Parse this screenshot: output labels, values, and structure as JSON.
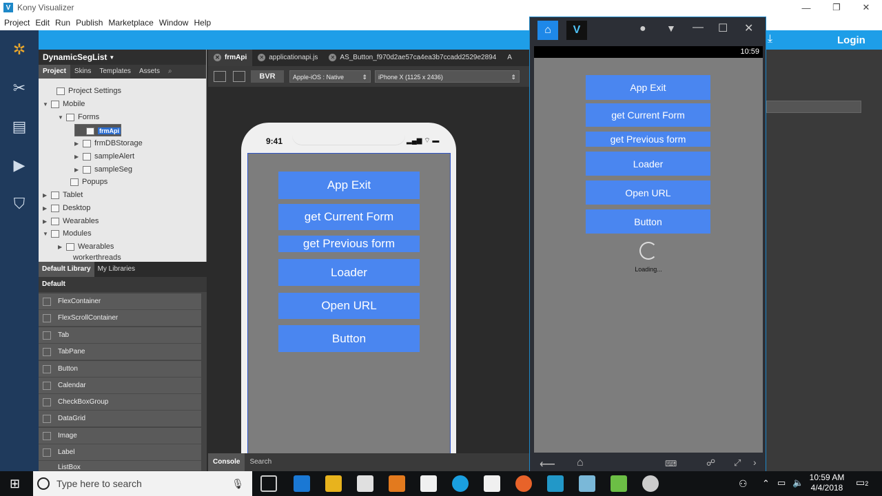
{
  "app": {
    "title": "Kony Visualizer",
    "logo": "V",
    "menu": [
      "Project",
      "Edit",
      "Run",
      "Publish",
      "Marketplace",
      "Window",
      "Help"
    ]
  },
  "login": "Login",
  "project": {
    "name": "DynamicSegList",
    "tabs": [
      "Project",
      "Skins",
      "Templates",
      "Assets"
    ],
    "tree": [
      "Project Settings",
      "Mobile",
      "Forms",
      "frmApi",
      "frmDBStorage",
      "sampleAlert",
      "sampleSeg",
      "Popups",
      "Tablet",
      "Desktop",
      "Wearables",
      "Modules",
      "Wearables",
      "workerthreads"
    ]
  },
  "library": {
    "tabs": [
      "Default Library",
      "My Libraries"
    ],
    "section": "Default",
    "items": [
      "FlexContainer",
      "FlexScrollContainer",
      "Tab",
      "TabPane",
      "Button",
      "Calendar",
      "CheckBoxGroup",
      "DataGrid",
      "Image",
      "Label",
      "ListBox"
    ]
  },
  "editor": {
    "tabs": [
      "frmApi",
      "applicationapi.js",
      "AS_Button_f970d2ae57ca4ea3b7ccadd2529e2894",
      "A"
    ],
    "bvr": "BVR",
    "platform": "Apple-iOS : Native",
    "device": "iPhone X (1125 x 2436)",
    "phone_time": "9:41",
    "buttons": [
      "App Exit",
      "get Current Form",
      "get Previous form",
      "Loader",
      "Open URL",
      "Button"
    ],
    "bottom_tabs": [
      "Console",
      "Search"
    ]
  },
  "emulator": {
    "time": "10:59",
    "buttons": [
      "App Exit",
      "get Current Form",
      "get Previous form",
      "Loader",
      "Open URL",
      "Button"
    ],
    "loading": "Loading..."
  },
  "taskbar": {
    "search_placeholder": "Type here to search",
    "time": "10:59 AM",
    "date": "4/4/2018",
    "notif": "2"
  }
}
